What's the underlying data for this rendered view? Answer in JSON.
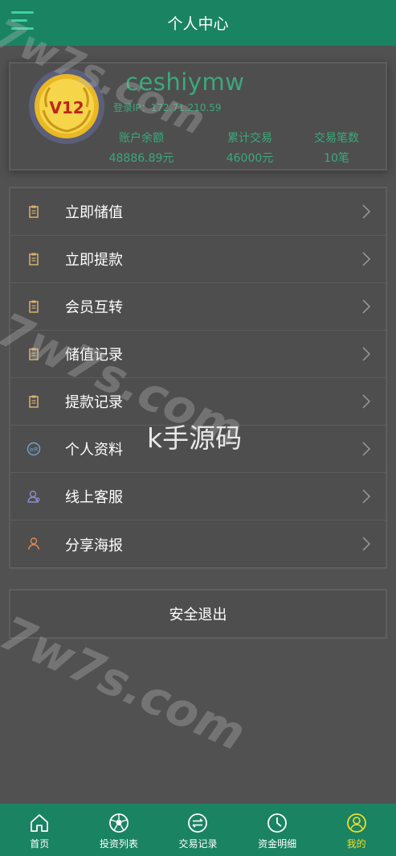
{
  "header": {
    "title": "个人中心",
    "menu_icon": "hamburger-menu-icon",
    "background": "#1a8361"
  },
  "profile": {
    "vip_level": "V12",
    "username": "ceshiymw",
    "login_ip": "登录IP：172.71.210.59",
    "stats": [
      {
        "label": "账户余额",
        "value": "48886.89元"
      },
      {
        "label": "累计交易",
        "value": "46000元"
      },
      {
        "label": "交易笔数",
        "value": "10笔"
      }
    ],
    "accent": "#3aa97c"
  },
  "menu": {
    "items": [
      {
        "label": "立即储值",
        "icon": "clipboard-icon"
      },
      {
        "label": "立即提款",
        "icon": "clipboard-icon"
      },
      {
        "label": "会员互转",
        "icon": "clipboard-icon"
      },
      {
        "label": "储值记录",
        "icon": "clipboard-icon"
      },
      {
        "label": "提款记录",
        "icon": "clipboard-icon"
      },
      {
        "label": "个人资料",
        "icon": "profile-card-icon"
      },
      {
        "label": "线上客服",
        "icon": "customer-service-icon"
      },
      {
        "label": "分享海报",
        "icon": "share-user-icon"
      }
    ]
  },
  "logout_label": "安全退出",
  "watermarks": {
    "site": "7w7s.com",
    "center": "k手源码"
  },
  "tabbar": {
    "items": [
      {
        "label": "首页",
        "icon": "home-icon",
        "active": false
      },
      {
        "label": "投资列表",
        "icon": "ball-icon",
        "active": false
      },
      {
        "label": "交易记录",
        "icon": "exchange-icon",
        "active": false
      },
      {
        "label": "资金明细",
        "icon": "clock-icon",
        "active": false
      },
      {
        "label": "我的",
        "icon": "user-circle-icon",
        "active": true
      }
    ],
    "active_color": "#f2dc28"
  }
}
